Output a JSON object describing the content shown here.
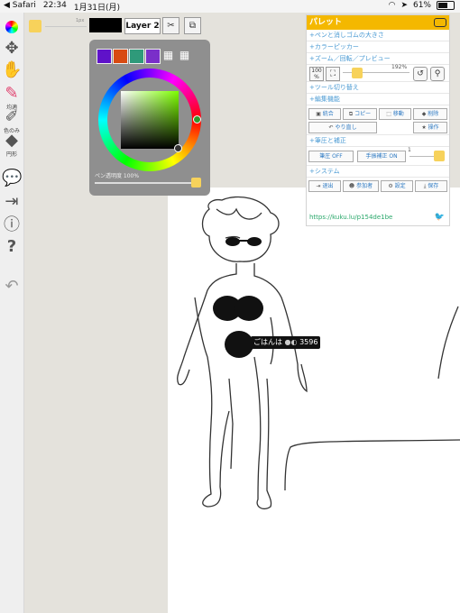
{
  "statusbar": {
    "app": "◀ Safari",
    "time": "22:34",
    "date": "1月31日(月)",
    "battery": "61%"
  },
  "toolbar": {
    "size_label": "1px",
    "layer_label": "Layer 2",
    "color_swatch": "#f7d25b",
    "tools": [
      {
        "icon": "color-wheel-icon"
      },
      {
        "icon": "move-icon"
      },
      {
        "icon": "hand-icon"
      },
      {
        "icon": "pen-icon",
        "label": "均適"
      },
      {
        "icon": "eraser-icon",
        "label": "色のみ"
      },
      {
        "icon": "fill-icon",
        "label": "円形"
      },
      {
        "icon": "chat-icon"
      },
      {
        "icon": "exit-icon"
      },
      {
        "icon": "info-icon"
      },
      {
        "icon": "help-icon"
      },
      {
        "icon": "undo-icon"
      }
    ]
  },
  "color_picker": {
    "swatches": [
      "#5f12c9",
      "#d84a12",
      "#2f9a7a",
      "#7a2fc9"
    ],
    "pen_opacity_label": "ペン透明度 100%"
  },
  "palette": {
    "title": "パレット",
    "sections": {
      "pen_size": "+ペンと消しゴムの大きさ",
      "color_picker": "+カラーピッカー",
      "zoom": "+ズーム／回転／プレビュー",
      "tool_switch": "+ツール切り替え",
      "edit": "+編集機能",
      "pressure": "+筆圧と補正",
      "system": "+システム"
    },
    "zoom_100_label": "100",
    "zoom_100_sub": "%",
    "zoom_value": "192%",
    "edit_buttons": {
      "merge": "統合",
      "copy": "コピー",
      "move": "移動",
      "delete": "削除",
      "redo": "やり直し",
      "operation": "操作"
    },
    "pressure": {
      "off": "筆圧 OFF",
      "hand_correct": "手振補正 ON",
      "value": "1"
    },
    "system": {
      "exit": "退出",
      "participants": "参加者",
      "settings": "設定",
      "save": "保存"
    },
    "url": "https://kuku.lu/p154de1be"
  },
  "canvas": {
    "tag_text": "ごはんは",
    "tag_number": "3596"
  }
}
